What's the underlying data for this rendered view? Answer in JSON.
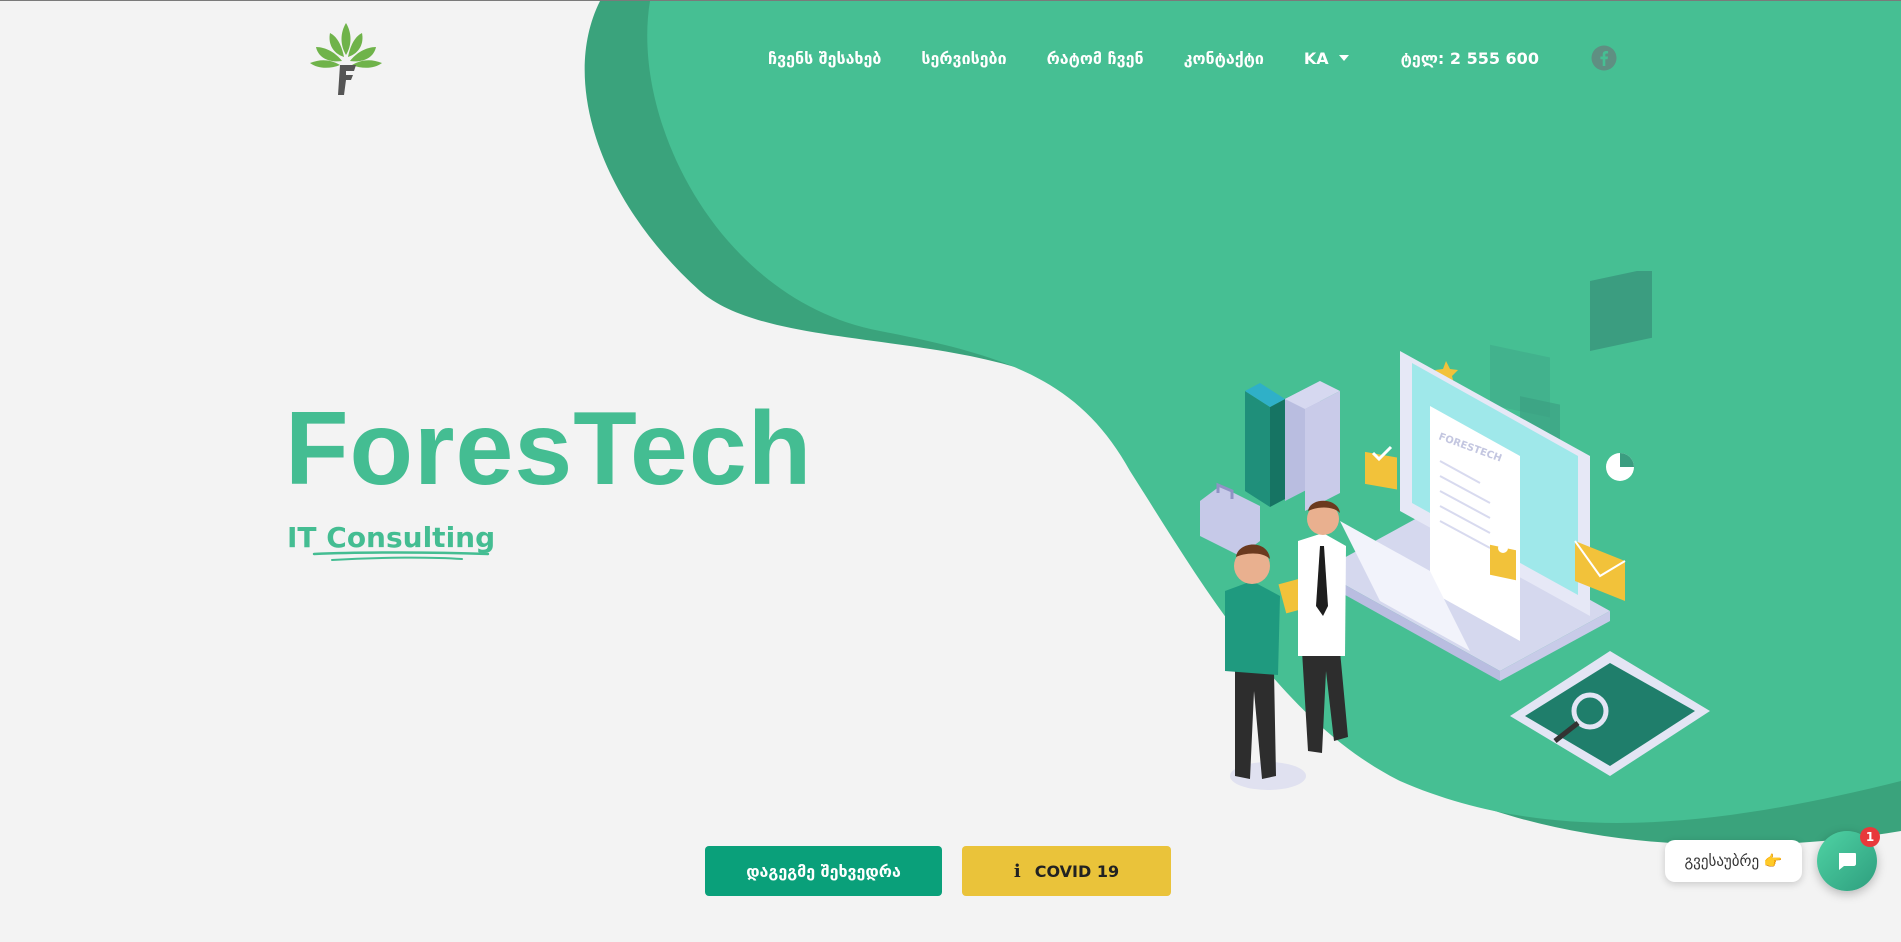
{
  "nav": {
    "items": [
      {
        "label": "ჩვენს შესახებ"
      },
      {
        "label": "სერვისები"
      },
      {
        "label": "რატომ ჩვენ"
      },
      {
        "label": "კონტაქტი"
      }
    ],
    "language": "KA",
    "phone": "ტელ: 2 555 600"
  },
  "hero": {
    "title": "ForesTech",
    "subtitle": "IT Consulting",
    "illustration_text": "FORESTECH"
  },
  "buttons": {
    "meeting": "დაგეგმე შეხვედრა",
    "covid": "COVID 19"
  },
  "chat": {
    "bubble": "გვესაუბრე 👉",
    "badge": "1"
  },
  "colors": {
    "brand_green": "#44bd92",
    "dark_green": "#3aa37c",
    "button_green": "#0aa07a",
    "covid_yellow": "#eac33a",
    "badge_red": "#e8393b"
  },
  "icons": {
    "facebook": "facebook-icon",
    "caret": "chevron-down-icon",
    "info": "info-icon",
    "chat": "chat-icon"
  }
}
